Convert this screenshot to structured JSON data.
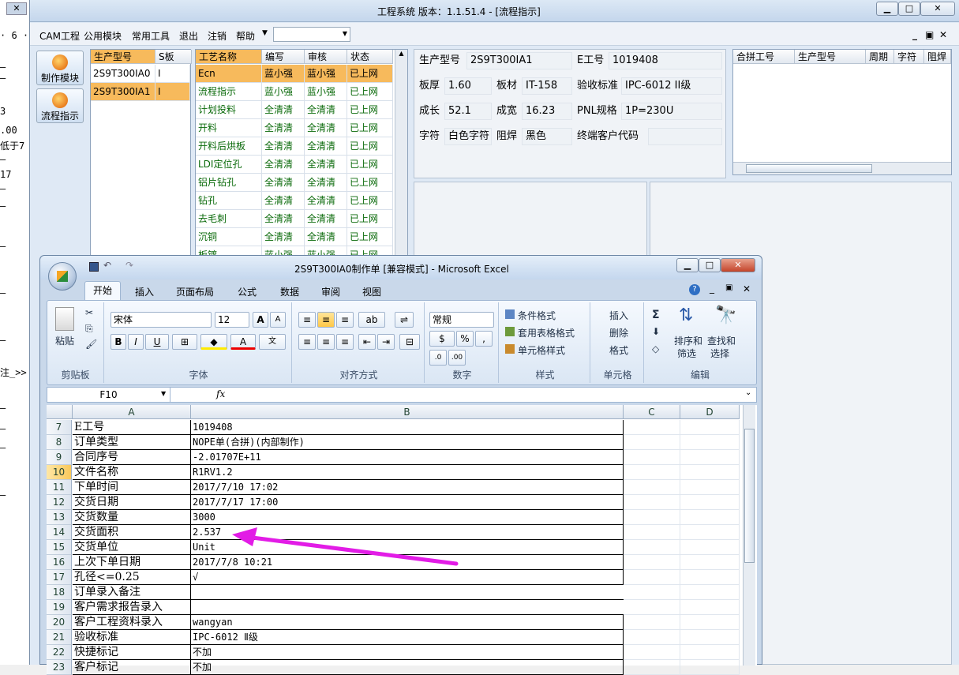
{
  "left_window": {
    "close": "✕",
    "lines": [
      "· 6 ·",
      "—",
      "—",
      "3",
      ".00",
      "低于7",
      "—",
      "17",
      "—",
      "—",
      "—",
      "—",
      "—",
      "注_>>",
      "—",
      "—",
      "—",
      "—"
    ]
  },
  "app": {
    "title": "工程系统    版本：1.1.51.4 - [流程指示]",
    "menu": [
      "CAM工程",
      "公用模块",
      "常用工具",
      "退出",
      "注销",
      "帮助"
    ],
    "modules": [
      "制作模块",
      "流程指示"
    ],
    "model_grid": {
      "headers": [
        "生产型号",
        "S板"
      ],
      "rows": [
        [
          "2S9T300IA0",
          "I"
        ],
        [
          "2S9T300IA1",
          "I"
        ]
      ]
    },
    "process_grid": {
      "headers": [
        "工艺名称",
        "编写",
        "审核",
        "状态"
      ],
      "rows": [
        [
          "Ecn",
          "蓝小强",
          "蓝小强",
          "已上网"
        ],
        [
          "流程指示",
          "蓝小强",
          "蓝小强",
          "已上网"
        ],
        [
          "计划投料",
          "全清清",
          "全清清",
          "已上网"
        ],
        [
          "开料",
          "全清清",
          "全清清",
          "已上网"
        ],
        [
          "开料后烘板",
          "全清清",
          "全清清",
          "已上网"
        ],
        [
          "LDI定位孔",
          "全清清",
          "全清清",
          "已上网"
        ],
        [
          "铝片钻孔",
          "全清清",
          "全清清",
          "已上网"
        ],
        [
          "钻孔",
          "全清清",
          "全清清",
          "已上网"
        ],
        [
          "去毛刺",
          "全清清",
          "全清清",
          "已上网"
        ],
        [
          "沉铜",
          "全清清",
          "全清清",
          "已上网"
        ],
        [
          "板镀",
          "蓝小强",
          "蓝小强",
          "已上网"
        ]
      ]
    },
    "info": {
      "prod_model_label": "生产型号",
      "prod_model": "2S9T300IA1",
      "e_no_label": "E工号",
      "e_no": "1019408",
      "thickness_label": "板厚",
      "thickness": "1.60",
      "material_label": "板材",
      "material": "IT-158",
      "standard_label": "验收标准",
      "standard": "IPC-6012 II级",
      "length_label": "成长",
      "length": "52.1",
      "width_label": "成宽",
      "width": "16.23",
      "pnl_label": "PNL规格",
      "pnl": "1P=230U",
      "char_label": "字符",
      "char": "白色字符",
      "mask_label": "阻焊",
      "mask": "黑色",
      "customer_label": "终端客户代码",
      "customer": ""
    },
    "merge_grid": {
      "headers": [
        "合拼工号",
        "生产型号",
        "周期",
        "字符",
        "阻焊"
      ]
    }
  },
  "excel": {
    "title": "2S9T300IA0制作单  [兼容模式] - Microsoft Excel",
    "tabs": [
      "开始",
      "插入",
      "页面布局",
      "公式",
      "数据",
      "审阅",
      "视图"
    ],
    "ribbon": {
      "paste": "粘贴",
      "clipboard": "剪贴板",
      "font_name": "宋体",
      "font_size": "12",
      "font": "字体",
      "align": "对齐方式",
      "number_format": "常规",
      "number": "数字",
      "cond_format": "条件格式",
      "table_format": "套用表格格式",
      "cell_style": "单元格样式",
      "styles": "样式",
      "insert": "插入",
      "delete": "删除",
      "format": "格式",
      "cells": "单元格",
      "sort": "排序和\n筛选",
      "sort1": "排序和",
      "sort2": "筛选",
      "find1": "查找和",
      "find2": "选择",
      "edit": "编辑"
    },
    "name_box": "F10",
    "columns": [
      "A",
      "B",
      "C",
      "D"
    ],
    "rows": [
      {
        "n": "7",
        "a": "E工号",
        "b": "1019408"
      },
      {
        "n": "8",
        "a": "订单类型",
        "b": "NOPE单(合拼)(内部制作)"
      },
      {
        "n": "9",
        "a": "合同序号",
        "b": "-2.01707E+11"
      },
      {
        "n": "10",
        "a": "文件名称",
        "b": "R1RV1.2"
      },
      {
        "n": "11",
        "a": "下单时间",
        "b": "2017/7/10 17:02"
      },
      {
        "n": "12",
        "a": "交货日期",
        "b": "2017/7/17 17:00"
      },
      {
        "n": "13",
        "a": "交货数量",
        "b": "3000"
      },
      {
        "n": "14",
        "a": "交货面积",
        "b": "2.537"
      },
      {
        "n": "15",
        "a": "交货单位",
        "b": "Unit"
      },
      {
        "n": "16",
        "a": "上次下单日期",
        "b": "2017/7/8 10:21"
      },
      {
        "n": "17",
        "a": "孔径<=0.25",
        "b": "√"
      },
      {
        "n": "18",
        "a": "订单录入备注",
        "b": ""
      },
      {
        "n": "19",
        "a": "客户需求报告录入",
        "b": ""
      },
      {
        "n": "20",
        "a": "客户工程资料录入",
        "b": "wangyan"
      },
      {
        "n": "21",
        "a": "验收标准",
        "b": "IPC-6012 Ⅱ级"
      },
      {
        "n": "22",
        "a": "快捷标记",
        "b": "不加"
      },
      {
        "n": "23",
        "a": "客户标记",
        "b": "不加"
      }
    ]
  },
  "annotation_color": "#e21ce6"
}
